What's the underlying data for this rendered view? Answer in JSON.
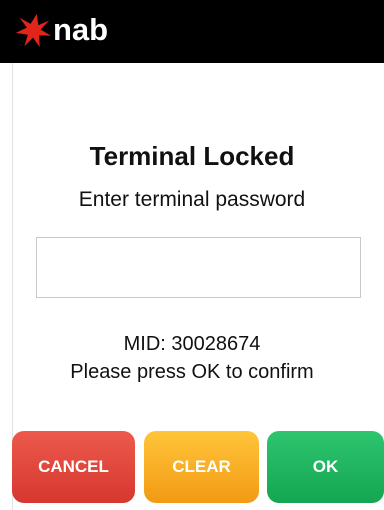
{
  "header": {
    "brand": "nab",
    "logo_icon": "nab-star-icon",
    "logo_color": "#e1251b",
    "background": "#000000"
  },
  "main": {
    "title": "Terminal Locked",
    "subtitle": "Enter terminal password",
    "password": {
      "value": "",
      "placeholder": ""
    },
    "mid": "MID: 30028674",
    "instruction": "Please press OK to confirm"
  },
  "buttons": {
    "cancel": {
      "label": "CANCEL",
      "color": "#e0463c"
    },
    "clear": {
      "label": "CLEAR",
      "color": "#f7ac25"
    },
    "ok": {
      "label": "OK",
      "color": "#1fb35d"
    }
  }
}
